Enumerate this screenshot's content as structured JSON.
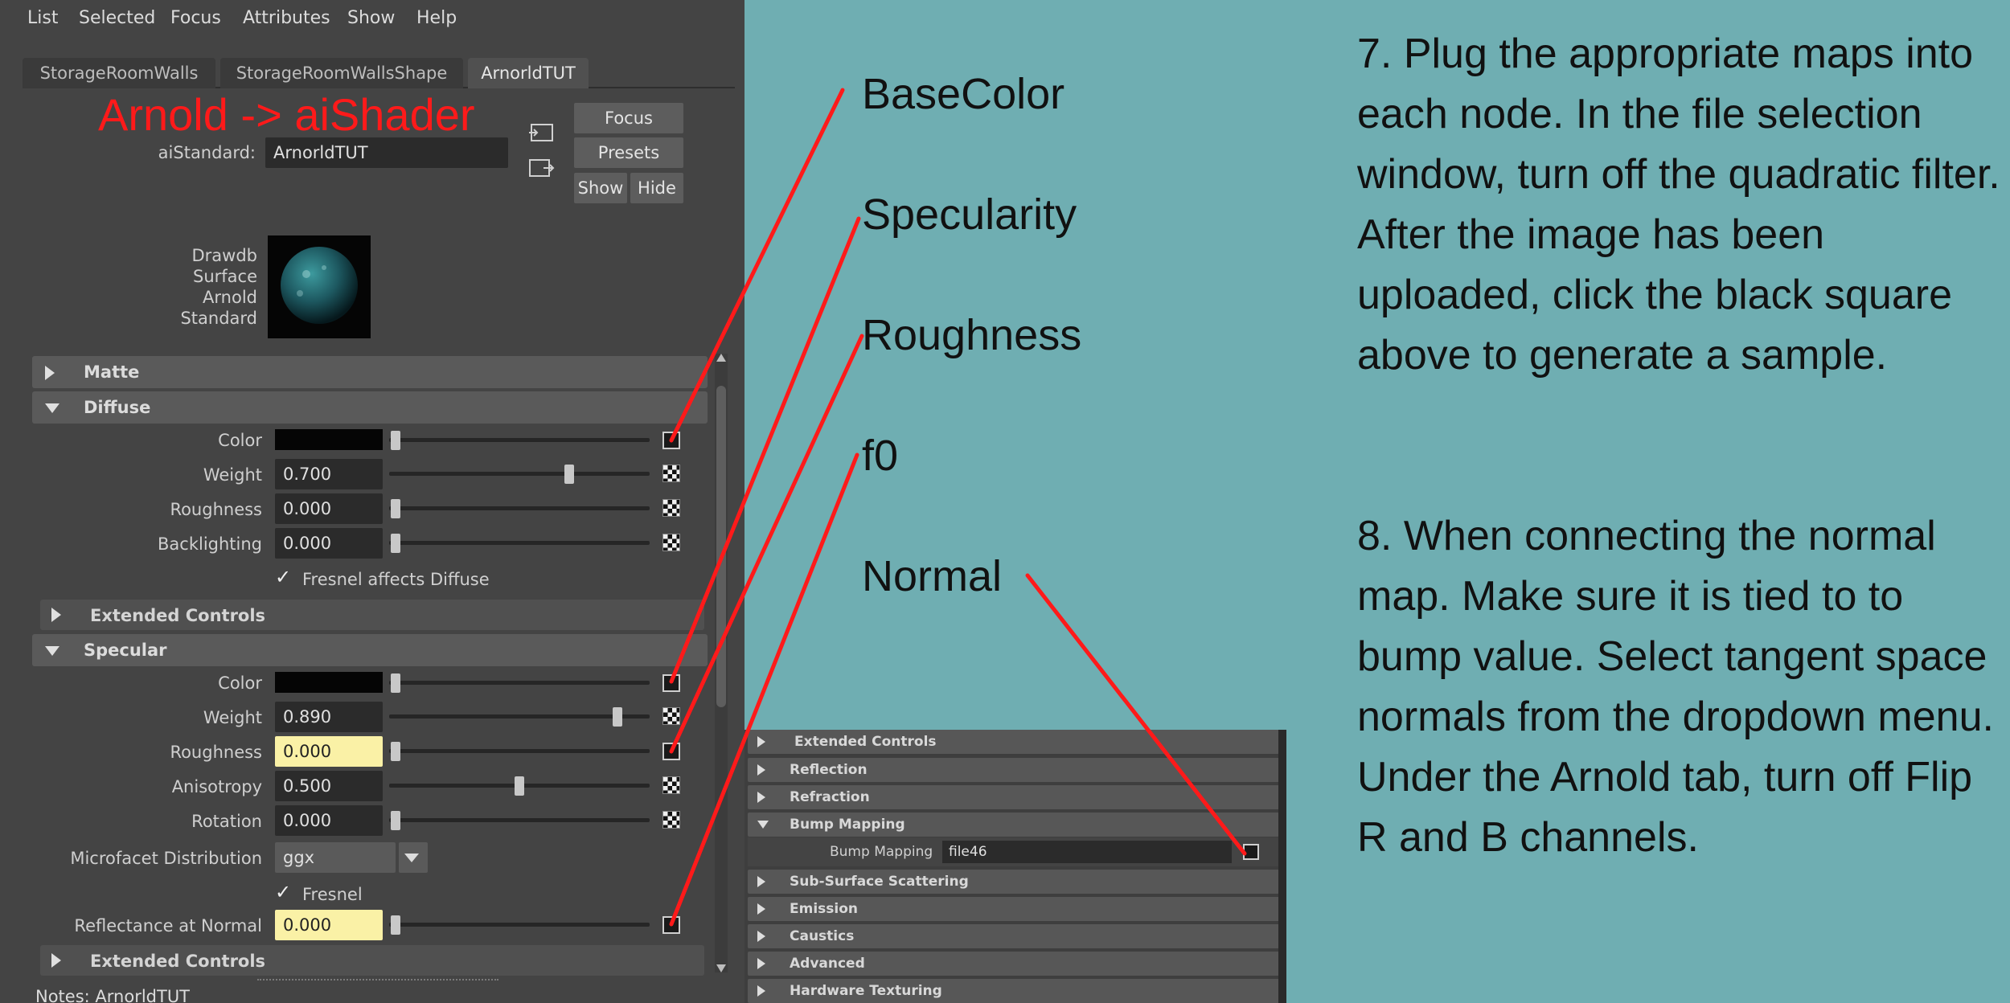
{
  "menubar": {
    "items": [
      "List",
      "Selected",
      "Focus",
      "Attributes",
      "Show",
      "Help"
    ]
  },
  "tabs": [
    "StorageRoomWalls",
    "StorageRoomWallsShape",
    "ArnorldTUT"
  ],
  "annotation_title": "Arnold -> aiShader",
  "node": {
    "type_label": "aiStandard:",
    "name": "ArnorldTUT"
  },
  "side_buttons": {
    "focus": "Focus",
    "presets": "Presets",
    "show": "Show",
    "hide": "Hide"
  },
  "swatch_caption": [
    "Drawdb",
    "Surface",
    "Arnold",
    "Standard"
  ],
  "sections": {
    "matte": "Matte",
    "diffuse": "Diffuse",
    "diffuse_ext": "Extended Controls",
    "specular": "Specular",
    "specular_ext": "Extended Controls"
  },
  "diffuse": {
    "color_label": "Color",
    "weight_label": "Weight",
    "weight_value": "0.700",
    "weight_level": 0.7,
    "roughness_label": "Roughness",
    "roughness_value": "0.000",
    "backlighting_label": "Backlighting",
    "backlighting_value": "0.000",
    "fresnel_check": "✓",
    "fresnel_label": "Fresnel affects Diffuse"
  },
  "specular": {
    "color_label": "Color",
    "weight_label": "Weight",
    "weight_value": "0.890",
    "weight_level": 0.89,
    "roughness_label": "Roughness",
    "roughness_value": "0.000",
    "anisotropy_label": "Anisotropy",
    "anisotropy_value": "0.500",
    "anisotropy_level": 0.5,
    "rotation_label": "Rotation",
    "rotation_value": "0.000",
    "microfacet_label": "Microfacet Distribution",
    "microfacet_value": "ggx",
    "fresnel_check": "✓",
    "fresnel_label": "Fresnel",
    "reflectance_label": "Reflectance at Normal",
    "reflectance_value": "0.000"
  },
  "notes": "Notes:  ArnorldTUT",
  "callouts": [
    "BaseColor",
    "Specularity",
    "Roughness",
    "f0",
    "Normal"
  ],
  "bump_panel": {
    "rows": [
      "Extended Controls",
      "Reflection",
      "Refraction",
      "Bump Mapping"
    ],
    "bump_label": "Bump Mapping",
    "bump_value": "file46",
    "rows_after": [
      "Sub-Surface Scattering",
      "Emission",
      "Caustics",
      "Advanced",
      "Hardware Texturing"
    ]
  },
  "instructions": {
    "step7": "7. Plug the appropriate maps into each node. In the file selection window, turn off the quadratic filter. After the image has been uploaded, click the black square above to generate a sample.",
    "step8": "8. When connecting the normal map. Make sure it is tied to to bump value. Select tangent space normals from the dropdown menu. Under the Arnold tab, turn off Flip R and B channels."
  },
  "colors": {
    "panel_bg": "#444444",
    "canvas_bg": "#6faeb2",
    "annotation_red": "#ff1a1a",
    "highlight_field": "#faf1a6"
  }
}
